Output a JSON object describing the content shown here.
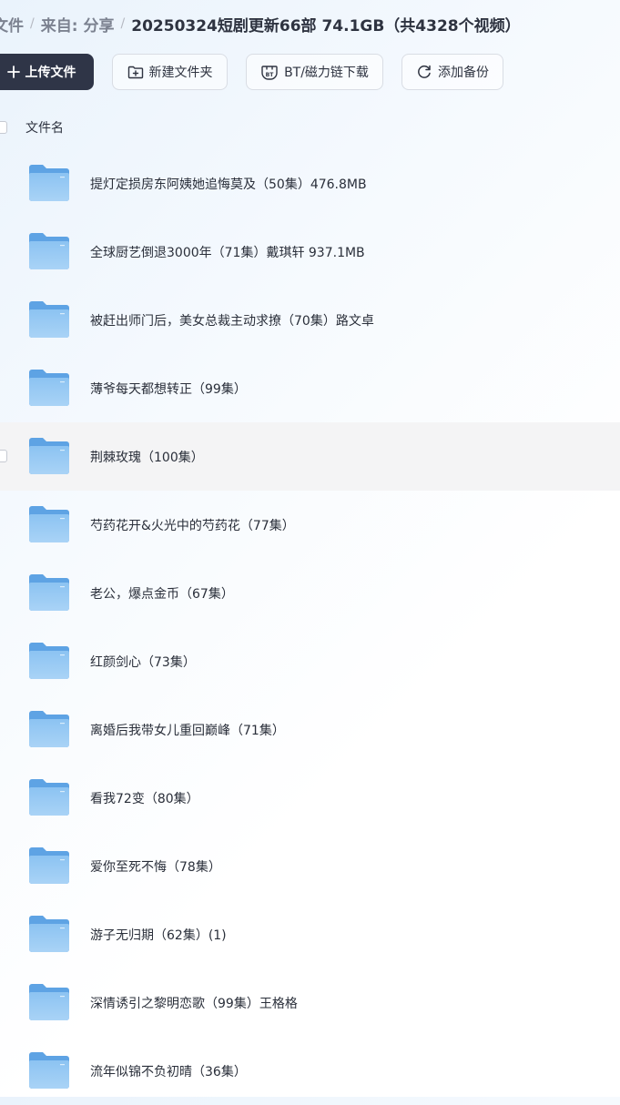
{
  "breadcrumb": {
    "root": "文件",
    "from": "来自:",
    "share": "分享",
    "current": "20250324短剧更新66部 74.1GB（共4328个视频）"
  },
  "toolbar": {
    "upload_label": "上传文件",
    "new_folder_label": "新建文件夹",
    "bt_label": "BT/磁力链下载",
    "backup_label": "添加备份"
  },
  "list_header": {
    "name_label": "文件名"
  },
  "colors": {
    "primary_button": "#2f3547",
    "folder": "#6fb0ea",
    "row_hover": "#f4f4f5"
  },
  "files": [
    {
      "name": "提灯定损房东阿姨她追悔莫及（50集）476.8MB"
    },
    {
      "name": "全球厨艺倒退3000年（71集）戴琪轩 937.1MB"
    },
    {
      "name": "被赶出师门后，美女总裁主动求撩（70集）路文卓"
    },
    {
      "name": "薄爷每天都想转正（99集）"
    },
    {
      "name": "荆棘玫瑰（100集）"
    },
    {
      "name": "芍药花开&火光中的芍药花（77集）"
    },
    {
      "name": "老公，爆点金币（67集）"
    },
    {
      "name": "红颜剑心（73集）"
    },
    {
      "name": "离婚后我带女儿重回巅峰（71集）"
    },
    {
      "name": "看我72变（80集）"
    },
    {
      "name": "爱你至死不悔（78集）"
    },
    {
      "name": "游子无归期（62集）(1)"
    },
    {
      "name": "深情诱引之黎明恋歌（99集）王格格"
    },
    {
      "name": "流年似锦不负初晴（36集）"
    }
  ]
}
